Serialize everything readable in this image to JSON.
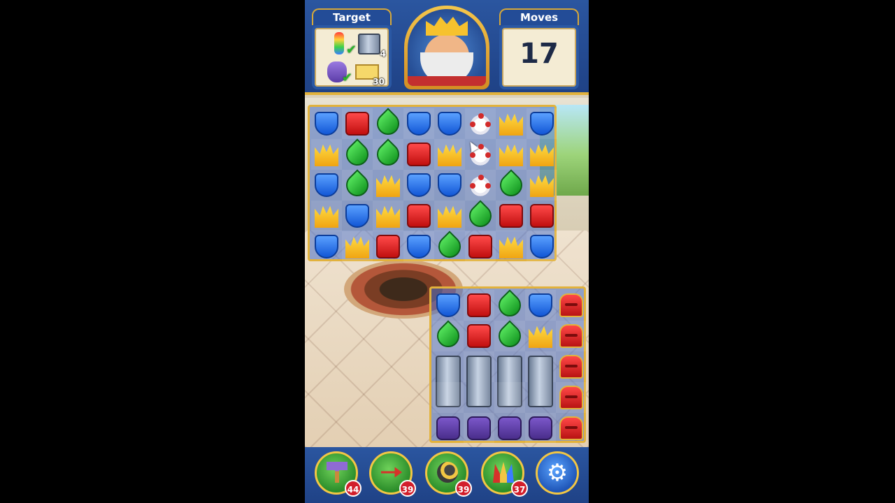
{
  "header": {
    "target_label": "Target",
    "moves_label": "Moves",
    "moves_value": "17",
    "targets": [
      {
        "name": "rocket",
        "status": "done"
      },
      {
        "name": "can",
        "count": "4"
      },
      {
        "name": "vase",
        "status": "done"
      },
      {
        "name": "mail",
        "count": "30"
      }
    ]
  },
  "board_main": {
    "rows": [
      [
        "shield",
        "block",
        "leaf",
        "shield",
        "shield",
        "teapot",
        "crown",
        "shield"
      ],
      [
        "crown",
        "leaf",
        "leaf",
        "block",
        "crown",
        "teapot",
        "crown",
        "crown"
      ],
      [
        "shield",
        "leaf",
        "crown",
        "shield",
        "shield",
        "teapot",
        "leaf",
        "crown"
      ],
      [
        "crown",
        "shield",
        "crown",
        "block",
        "crown",
        "leaf",
        "block",
        "block"
      ],
      [
        "shield",
        "crown",
        "block",
        "shield",
        "leaf",
        "block",
        "crown",
        "shield"
      ]
    ]
  },
  "board_sub": {
    "rows": [
      [
        "shield",
        "block",
        "leaf",
        "shield",
        "mailbox"
      ],
      [
        "leaf",
        "block",
        "leaf",
        "crown",
        "mailbox"
      ],
      [
        "can",
        "can",
        "can",
        "can",
        "mailbox"
      ],
      [
        "can",
        "can",
        "can",
        "can",
        "mailbox"
      ],
      [
        "jar",
        "jar",
        "jar",
        "jar",
        "mailbox"
      ]
    ]
  },
  "boosters": [
    {
      "name": "hammer",
      "count": "44"
    },
    {
      "name": "arrow",
      "count": "39"
    },
    {
      "name": "cannon",
      "count": "39"
    },
    {
      "name": "jester-hat",
      "count": "37"
    }
  ],
  "colors": {
    "header_blue": "#2b56a0",
    "gold": "#e2b23c",
    "shield": "#1257d6",
    "block": "#c10f0f",
    "leaf": "#179a24",
    "crown": "#f0a412"
  }
}
